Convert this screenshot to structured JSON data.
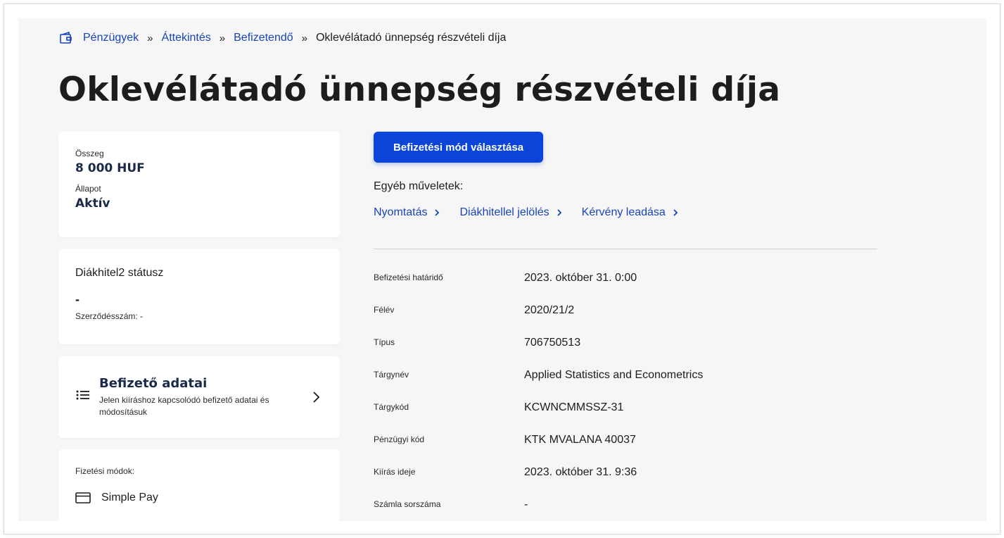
{
  "breadcrumb": {
    "items": [
      "Pénzügyek",
      "Áttekintés",
      "Befizetendő"
    ],
    "separator": "»",
    "current": "Oklevélátadó ünnepség részvételi díja",
    "home_icon": "wallet-icon"
  },
  "page": {
    "title": "Oklevélátadó ünnepség részvételi díja"
  },
  "summary": {
    "amount_label": "Összeg",
    "amount_value": "8 000 HUF",
    "status_label": "Állapot",
    "status_value": "Aktív"
  },
  "loan": {
    "title": "Diákhitel2 státusz",
    "value": "-",
    "contract": "Szerződésszám: -"
  },
  "payer": {
    "title": "Befizető adatai",
    "description": "Jelen kiíráshoz kapcsolódó befizető adatai és módosításuk",
    "icon": "list-icon"
  },
  "methods": {
    "label": "Fizetési módok:",
    "items": [
      {
        "name": "Simple Pay",
        "icon": "credit-card-icon"
      }
    ]
  },
  "primary_button": "Befizetési mód választása",
  "other_actions": {
    "label": "Egyéb műveletek:",
    "links": [
      "Nyomtatás",
      "Diákhitellel jelölés",
      "Kérvény leadása"
    ]
  },
  "details": [
    {
      "label": "Befizetési határidő",
      "value": "2023. október 31. 0:00"
    },
    {
      "label": "Félév",
      "value": "2020/21/2"
    },
    {
      "label": "Típus",
      "value": "706750513"
    },
    {
      "label": "Tárgynév",
      "value": "Applied Statistics and Econometrics"
    },
    {
      "label": "Tárgykód",
      "value": "KCWNCMMSSZ-31"
    },
    {
      "label": "Pénzügyi kód",
      "value": "KTK MVALANA 40037"
    },
    {
      "label": "Kiírás ideje",
      "value": "2023. október 31. 9:36"
    },
    {
      "label": "Számla sorszáma",
      "value": "-"
    }
  ],
  "colors": {
    "link": "#1944b8",
    "primary": "#0b44d8",
    "background": "#f6f6f7",
    "card": "#ffffff",
    "heading": "#1a2a48"
  }
}
